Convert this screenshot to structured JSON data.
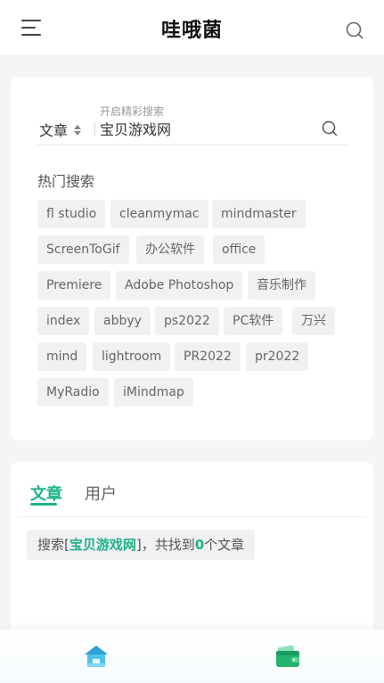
{
  "header": {
    "logo_text": "哇哦菌",
    "menu_icon": "menu-icon",
    "search_icon": "search-icon"
  },
  "search_panel": {
    "hint": "开启精彩搜索",
    "type_selected": "文章",
    "query": "宝贝游戏网",
    "hot_title": "热门搜索",
    "hot_tags": [
      "fl studio",
      "cleanmymac",
      "mindmaster",
      "ScreenToGif",
      "办公软件",
      "office",
      "Premiere",
      "Adobe Photoshop",
      "音乐制作",
      "index",
      "abbyy",
      "ps2022",
      "PC软件",
      "万兴",
      "mind",
      "lightroom",
      "PR2022",
      "pr2022",
      "MyRadio",
      "iMindmap"
    ]
  },
  "results_panel": {
    "tabs": [
      "文章",
      "用户"
    ],
    "active_tab": "文章",
    "result_prefix": "搜索[",
    "result_keyword": "宝贝游戏网",
    "result_mid": "]，共找到",
    "result_count": "0",
    "result_suffix": "个文章"
  },
  "bottom_nav": {
    "home_icon": "home-icon",
    "wallet_icon": "wallet-icon"
  },
  "colors": {
    "accent": "#1db38a",
    "tag_bg": "#f1f1f1",
    "page_bg": "#f4f5f7"
  }
}
